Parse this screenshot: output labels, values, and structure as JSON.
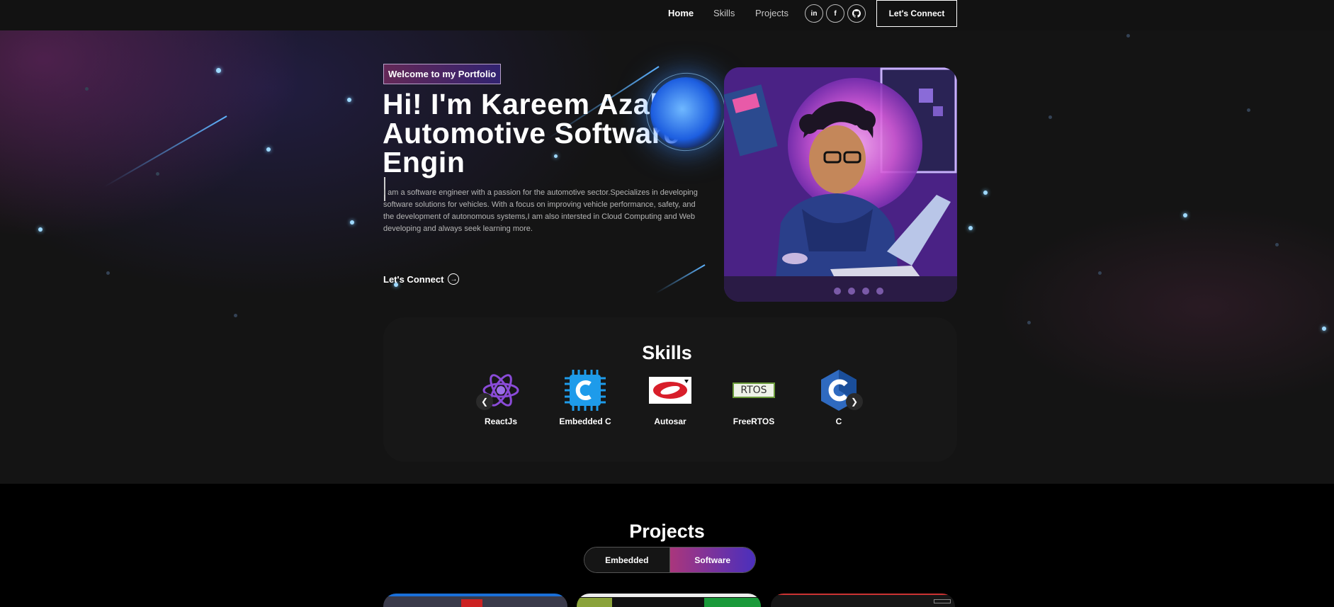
{
  "nav": {
    "links": [
      "Home",
      "Skills",
      "Projects"
    ],
    "socials": [
      {
        "label": "in",
        "icon": "linkedin-icon"
      },
      {
        "label": "f",
        "icon": "facebook-icon"
      },
      {
        "label": "",
        "icon": "github-icon"
      }
    ],
    "cta": "Let's Connect"
  },
  "hero": {
    "tagline": "Welcome to my Portfolio",
    "headline_line1": "Hi! I'm Kareem Azab",
    "headline_line2": "Automotive Software",
    "headline_line3": "Engin",
    "bio": "I am a software engineer with a passion for the automotive sector.Specializes in developing software solutions for vehicles. With a focus on improving vehicle performance, safety, and the development of autonomous systems,I am also intersted in Cloud Computing and Web developing and always seek learning more.",
    "cta": "Let's Connect"
  },
  "skills": {
    "title": "Skills",
    "items": [
      {
        "label": "ReactJs",
        "icon": "react-icon"
      },
      {
        "label": "Embedded C",
        "icon": "embedded-c-icon"
      },
      {
        "label": "Autosar",
        "icon": "autosar-icon"
      },
      {
        "label": "FreeRTOS",
        "icon": "freertos-icon",
        "logo_text": "RTOS"
      },
      {
        "label": "C",
        "icon": "c-language-icon"
      }
    ]
  },
  "projects": {
    "title": "Projects",
    "tabs": [
      "Embedded",
      "Software"
    ],
    "active_tab": "Software"
  },
  "colors": {
    "accent_pink": "#aa367c",
    "accent_purple": "#4a2fbd",
    "background": "#121212"
  }
}
